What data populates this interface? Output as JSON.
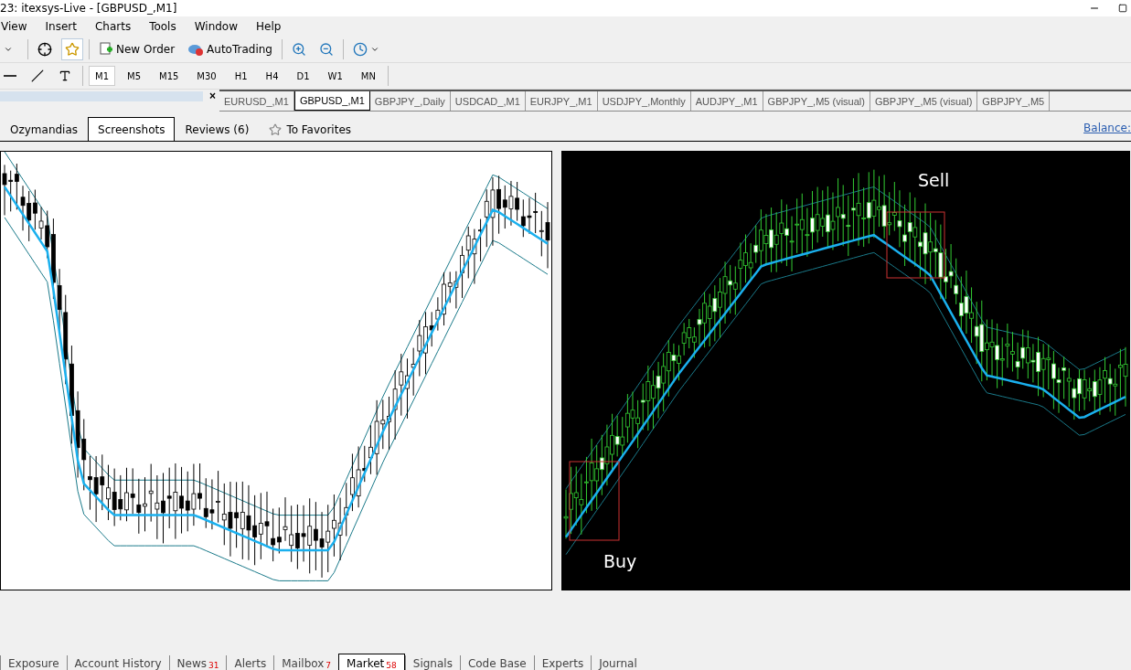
{
  "window": {
    "title": "23: itexsys-Live - [GBPUSD_,M1]"
  },
  "menu": [
    "View",
    "Insert",
    "Charts",
    "Tools",
    "Window",
    "Help"
  ],
  "toolbar": {
    "new_order": "New Order",
    "autotrading": "AutoTrading"
  },
  "timeframes": [
    {
      "label": "M1",
      "selected": true
    },
    {
      "label": "M5",
      "selected": false
    },
    {
      "label": "M15",
      "selected": false
    },
    {
      "label": "M30",
      "selected": false
    },
    {
      "label": "H1",
      "selected": false
    },
    {
      "label": "H4",
      "selected": false
    },
    {
      "label": "D1",
      "selected": false
    },
    {
      "label": "W1",
      "selected": false
    },
    {
      "label": "MN",
      "selected": false
    }
  ],
  "panel": {
    "close": "×"
  },
  "chart_tabs": [
    {
      "label": "EURUSD_,M1",
      "selected": false
    },
    {
      "label": "GBPUSD_,M1",
      "selected": true
    },
    {
      "label": "GBPJPY_,Daily",
      "selected": false
    },
    {
      "label": "USDCAD_,M1",
      "selected": false
    },
    {
      "label": "EURJPY_,M1",
      "selected": false
    },
    {
      "label": "USDJPY_,Monthly",
      "selected": false
    },
    {
      "label": "AUDJPY_,M1",
      "selected": false
    },
    {
      "label": "GBPJPY_,M5 (visual)",
      "selected": false
    },
    {
      "label": "GBPJPY_,M5 (visual)",
      "selected": false
    },
    {
      "label": "GBPJPY_,M5",
      "selected": false
    }
  ],
  "market_tabs": [
    {
      "label": "Ozymandias",
      "kind": "tab",
      "selected": false
    },
    {
      "label": "Screenshots",
      "kind": "tab",
      "selected": true
    },
    {
      "label": "Reviews (6)",
      "kind": "tab",
      "selected": false
    },
    {
      "label": "To Favorites",
      "kind": "favorite",
      "selected": false
    }
  ],
  "balance_link": "Balance:",
  "screenshots": [
    {
      "kind": "light"
    },
    {
      "kind": "dark",
      "labels": [
        {
          "text": "Sell",
          "kind": "sell"
        },
        {
          "text": "Buy",
          "kind": "buy"
        }
      ]
    }
  ],
  "bottom_tabs": [
    {
      "label": "Exposure",
      "selected": false
    },
    {
      "label": "Account History",
      "selected": false
    },
    {
      "label": "News",
      "count": "31",
      "selected": false
    },
    {
      "label": "Alerts",
      "selected": false
    },
    {
      "label": "Mailbox",
      "count": "7",
      "selected": false
    },
    {
      "label": "Market",
      "count": "58",
      "selected": true
    },
    {
      "label": "Signals",
      "selected": false
    },
    {
      "label": "Code Base",
      "selected": false
    },
    {
      "label": "Experts",
      "selected": false
    },
    {
      "label": "Journal",
      "selected": false
    }
  ]
}
